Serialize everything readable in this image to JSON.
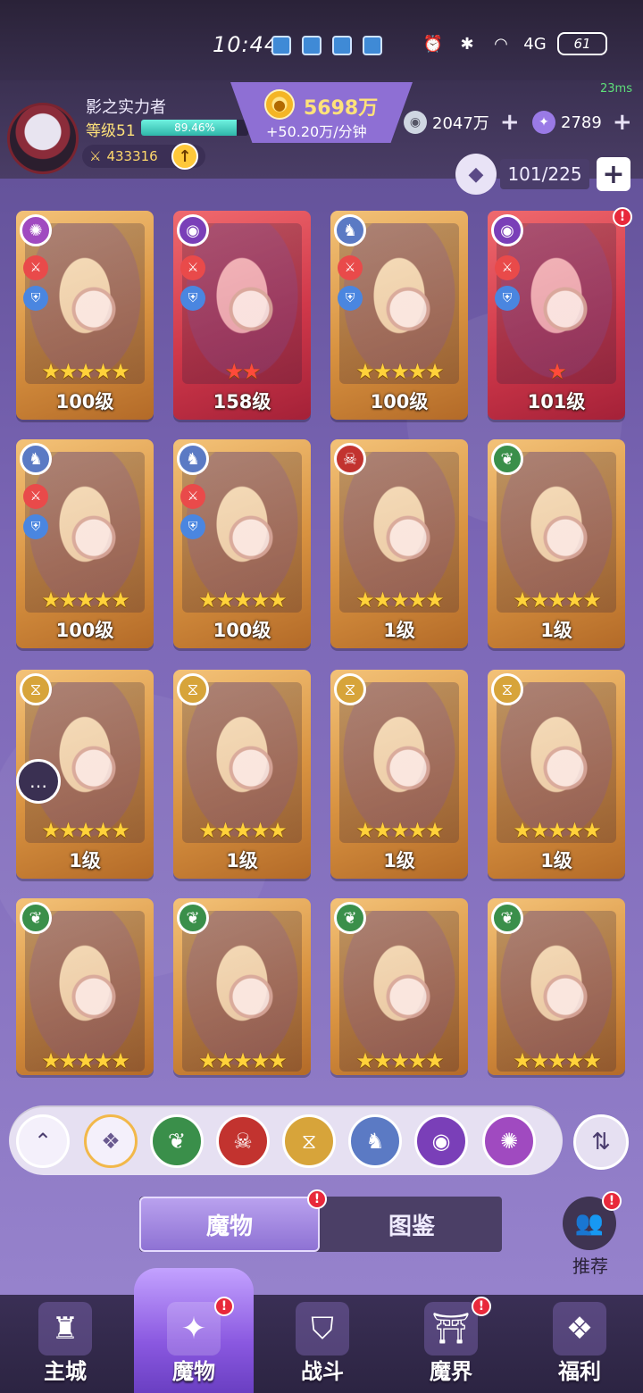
{
  "status_bar": {
    "time": "10:44",
    "network": "4G",
    "battery": "61"
  },
  "player": {
    "name": "影之实力者",
    "level": "等级51",
    "xp_percent": "89.46%",
    "xp_fraction": 0.8946,
    "power": "433316"
  },
  "currency": {
    "gold": "5698万",
    "gold_rate": "+50.20万/分钟",
    "silver": "2047万",
    "gems": "2789"
  },
  "ping": "23ms",
  "roster": {
    "count": "101/225"
  },
  "cards": [
    {
      "level": "100级",
      "stars": "★★★★★",
      "frame": "gold",
      "element": "swirl",
      "red_stars": false
    },
    {
      "level": "158级",
      "stars": "★★",
      "frame": "red",
      "element": "eye",
      "red_stars": true
    },
    {
      "level": "100级",
      "stars": "★★★★★",
      "frame": "gold",
      "element": "dragon",
      "red_stars": false
    },
    {
      "level": "101级",
      "stars": "★",
      "frame": "red",
      "element": "eye",
      "red_stars": true
    },
    {
      "level": "100级",
      "stars": "★★★★★",
      "frame": "gold",
      "element": "dragon",
      "red_stars": false
    },
    {
      "level": "100级",
      "stars": "★★★★★",
      "frame": "gold",
      "element": "dragon",
      "red_stars": false
    },
    {
      "level": "1级",
      "stars": "★★★★★",
      "frame": "gold",
      "element": "demon",
      "red_stars": false
    },
    {
      "level": "1级",
      "stars": "★★★★★",
      "frame": "gold",
      "element": "leaf",
      "red_stars": false
    },
    {
      "level": "1级",
      "stars": "★★★★★",
      "frame": "gold",
      "element": "hourglass",
      "red_stars": false
    },
    {
      "level": "1级",
      "stars": "★★★★★",
      "frame": "gold",
      "element": "hourglass",
      "red_stars": false
    },
    {
      "level": "1级",
      "stars": "★★★★★",
      "frame": "gold",
      "element": "hourglass",
      "red_stars": false
    },
    {
      "level": "1级",
      "stars": "★★★★★",
      "frame": "gold",
      "element": "hourglass",
      "red_stars": false
    },
    {
      "level": "",
      "stars": "★★★★★",
      "frame": "gold",
      "element": "leaf",
      "red_stars": false
    },
    {
      "level": "",
      "stars": "★★★★★",
      "frame": "gold",
      "element": "leaf",
      "red_stars": false
    },
    {
      "level": "",
      "stars": "★★★★★",
      "frame": "gold",
      "element": "leaf",
      "red_stars": false
    },
    {
      "level": "",
      "stars": "★★★★★",
      "frame": "gold",
      "element": "leaf",
      "red_stars": false
    }
  ],
  "filters": [
    "collapse-up",
    "all",
    "leaf",
    "demon",
    "hourglass",
    "dragon",
    "eye",
    "swirl"
  ],
  "tabs": {
    "active": "魔物",
    "inactive": "图鉴"
  },
  "recommend_label": "推荐",
  "bottom_nav": [
    "主城",
    "魔物",
    "战斗",
    "魔界",
    "福利"
  ],
  "colors": {
    "element_leaf": "#3a8f4a",
    "element_demon": "#c2332f",
    "element_hourglass": "#d7a43a",
    "element_dragon": "#5b7ac4",
    "element_eye": "#7a3fb8",
    "element_swirl": "#a04ac0",
    "accent": "#8e72d4"
  }
}
